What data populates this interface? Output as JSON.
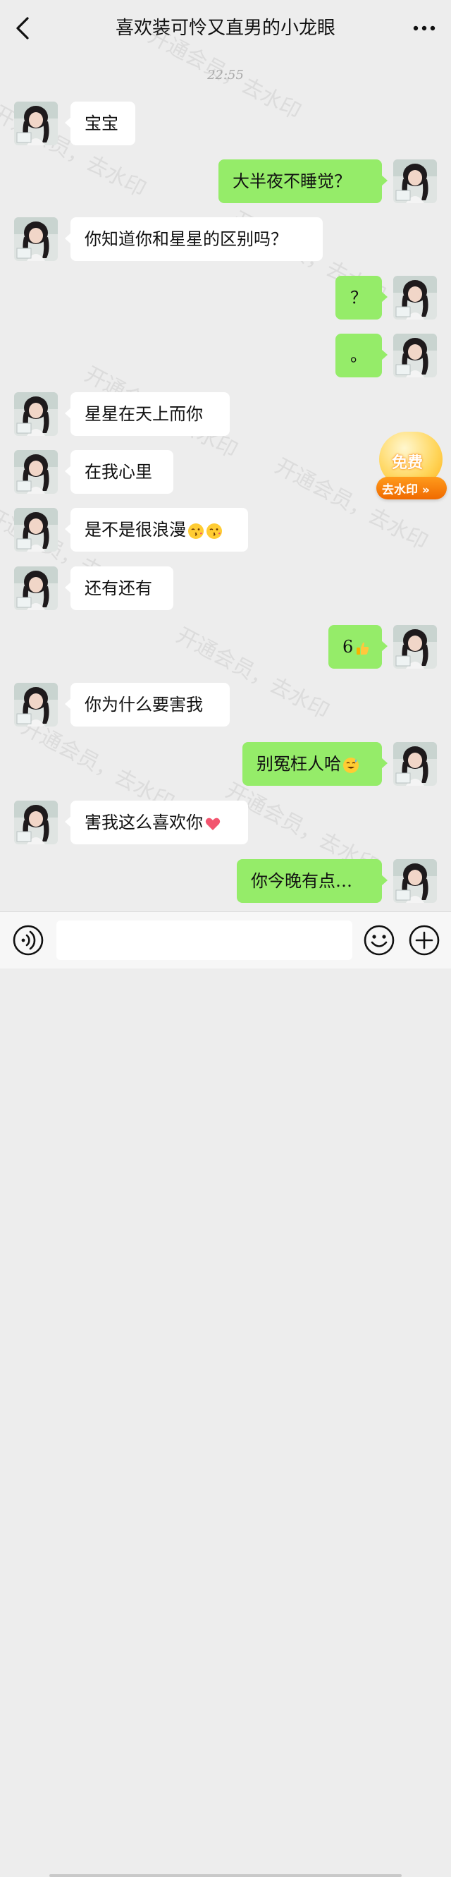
{
  "header": {
    "title": "喜欢装可怜又直男的小龙眼",
    "back_icon": "chevron-left-icon",
    "more_icon": "more-dots-icon"
  },
  "timestamp": "22:55",
  "watermark": {
    "text": "开通会员，去水印"
  },
  "promo_badge": {
    "free_label": "免费",
    "action_label": "去水印 »"
  },
  "messages": [
    {
      "side": "in",
      "text": "宝宝"
    },
    {
      "side": "out",
      "text": "大半夜不睡觉？"
    },
    {
      "side": "in",
      "text": "你知道你和星星的区别吗？"
    },
    {
      "side": "out",
      "text": "？"
    },
    {
      "side": "out",
      "text": "。"
    },
    {
      "side": "in",
      "text": "星星在天上而你"
    },
    {
      "side": "in",
      "text": "在我心里"
    },
    {
      "side": "in",
      "text": "是不是很浪漫",
      "emoji": [
        "kiss-face-emoji",
        "kiss-face-emoji"
      ]
    },
    {
      "side": "in",
      "text": "还有还有"
    },
    {
      "side": "out",
      "text": "6",
      "emoji": [
        "thumbs-up-emoji"
      ]
    },
    {
      "side": "in",
      "text": "你为什么要害我"
    },
    {
      "side": "out",
      "text": "别冤枉人哈",
      "emoji": [
        "sweat-smile-emoji"
      ]
    },
    {
      "side": "in",
      "text": "害我这么喜欢你",
      "emoji": [
        "heart-emoji"
      ]
    },
    {
      "side": "out",
      "text": "你今晚有点…"
    }
  ],
  "input_bar": {
    "voice_icon": "voice-icon",
    "emoji_icon": "emoji-icon",
    "plus_icon": "plus-icon",
    "placeholder": ""
  },
  "colors": {
    "background": "#ededed",
    "outgoing_bubble": "#95ec69",
    "incoming_bubble": "#ffffff",
    "badge_orange": "#f06a00"
  }
}
